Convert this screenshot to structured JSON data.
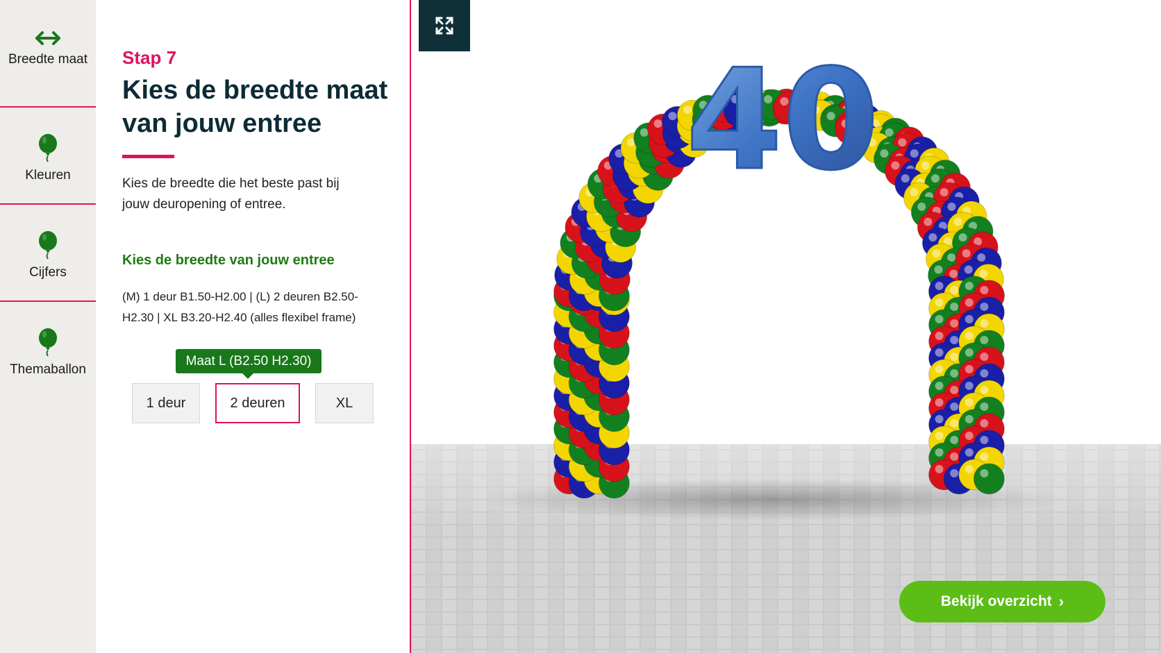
{
  "nav": {
    "items": [
      {
        "label": "Breedte maat",
        "icon": "double-arrow-icon"
      },
      {
        "label": "Kleuren",
        "icon": "balloon-icon"
      },
      {
        "label": "Cijfers",
        "icon": "balloon-icon"
      },
      {
        "label": "Themaballon",
        "icon": "balloon-icon"
      }
    ]
  },
  "panel": {
    "step": "Stap 7",
    "title": "Kies de breedte maat van jouw entree",
    "intro": "Kies de breedte die het beste past bij jouw deuropening of entree.",
    "subhead": "Kies de breedte van jouw entree",
    "sizes_info": "(M) 1 deur B1.50-H2.00 | (L) 2 deuren B2.50-H2.30 | XL B3.20-H2.40 (alles flexibel frame)",
    "tooltip": "Maat L (B2.50 H2.30)",
    "options": [
      {
        "label": "1 deur",
        "selected": false
      },
      {
        "label": "2 deuren",
        "selected": true
      },
      {
        "label": "XL",
        "selected": false
      }
    ]
  },
  "scene": {
    "arch_number": "40",
    "balloon_colors": [
      "#d8121b",
      "#1a1fa8",
      "#f3d600",
      "#12801f"
    ],
    "expand_icon": "expand-arrows-icon"
  },
  "cta": {
    "label": "Bekijk overzicht",
    "icon": "chevron-right-icon"
  },
  "colors": {
    "accent": "#e0115f",
    "green": "#1f7a12",
    "cta": "#5cbd17",
    "dark": "#0f3038"
  }
}
